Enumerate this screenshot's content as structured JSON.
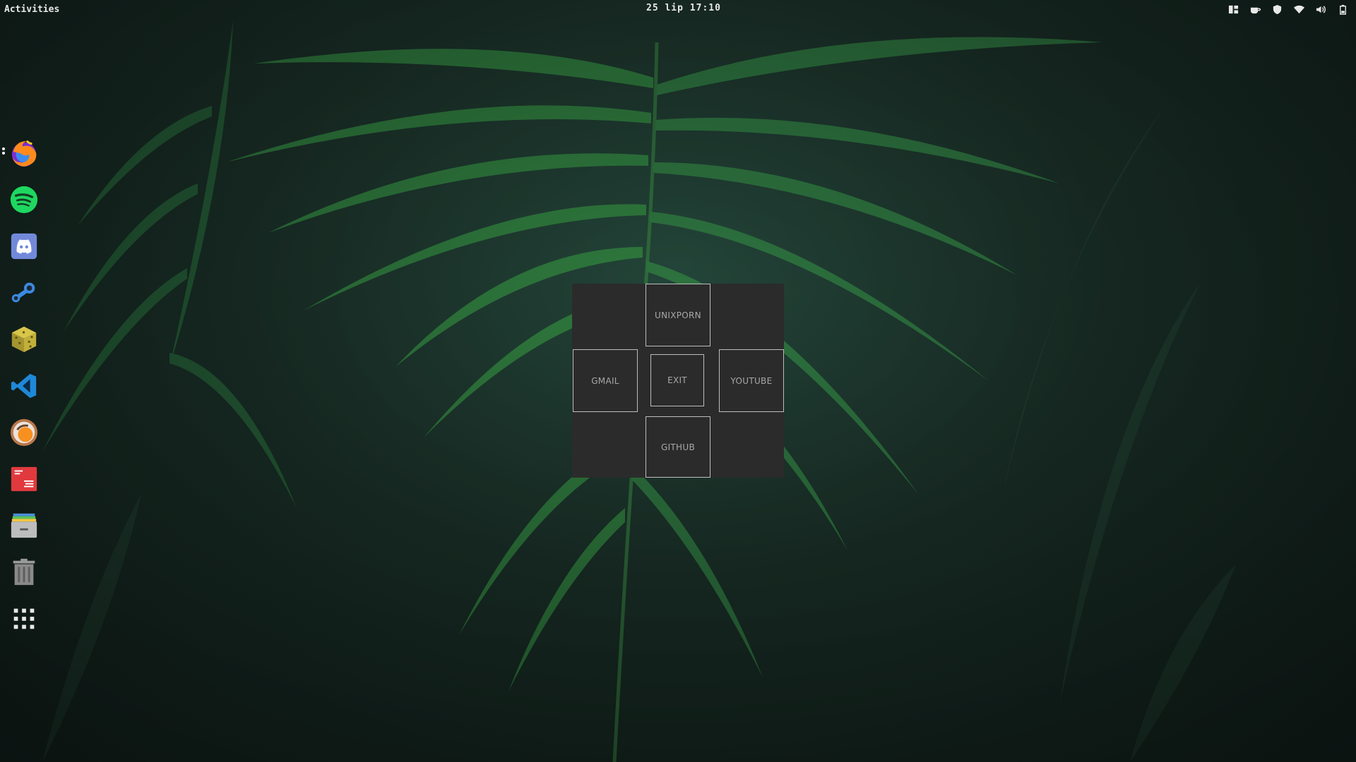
{
  "topbar": {
    "activities_label": "Activities",
    "clock": "25 lip 17:10",
    "tray_icons": [
      "window-switcher-icon",
      "coffee-cup-icon",
      "shield-icon",
      "wifi-icon",
      "volume-icon",
      "battery-icon"
    ]
  },
  "dock": {
    "items": [
      {
        "name": "firefox-icon",
        "running": true
      },
      {
        "name": "spotify-icon"
      },
      {
        "name": "discord-icon"
      },
      {
        "name": "steam-icon"
      },
      {
        "name": "minecraft-icon"
      },
      {
        "name": "vscode-icon"
      },
      {
        "name": "coffee-mug-app-icon"
      },
      {
        "name": "document-viewer-icon"
      },
      {
        "name": "file-archive-icon"
      },
      {
        "name": "trash-icon"
      },
      {
        "name": "show-applications-icon"
      }
    ]
  },
  "startpage": {
    "top": "UNIXPORN",
    "left": "GMAIL",
    "center": "EXIT",
    "right": "YOUTUBE",
    "bottom": "GITHUB"
  },
  "colors": {
    "widget_bg": "#2b2b2b",
    "button_border": "#bdbdbd",
    "button_text": "#a8a8a8",
    "wallpaper_dark": "#14241f",
    "leaf_green": "#2f7a3e"
  }
}
